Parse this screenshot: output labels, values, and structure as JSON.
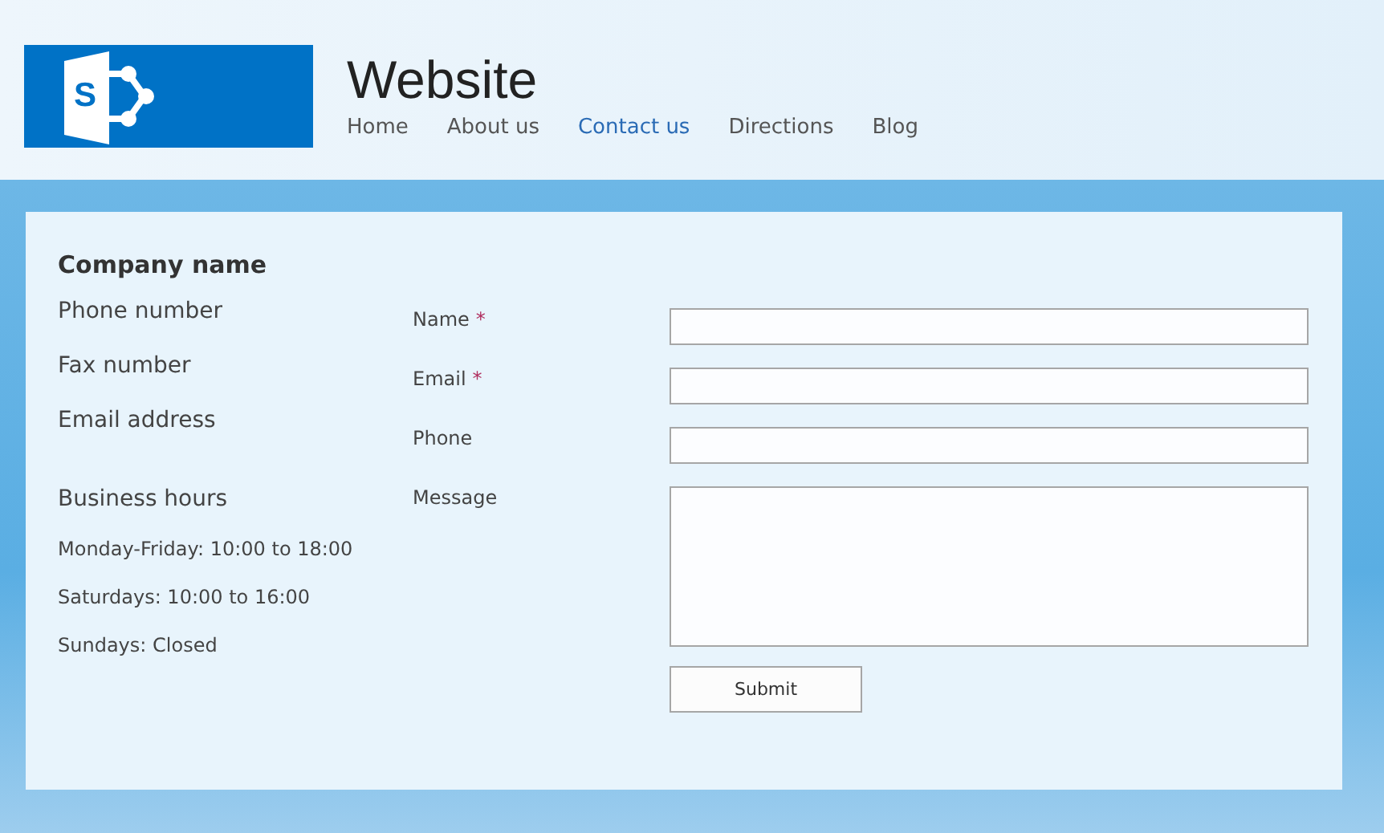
{
  "logo": {
    "letter": "S"
  },
  "site_title": "Website",
  "nav": [
    {
      "label": "Home",
      "selected": false
    },
    {
      "label": "About us",
      "selected": false
    },
    {
      "label": "Contact us",
      "selected": true
    },
    {
      "label": "Directions",
      "selected": false
    },
    {
      "label": "Blog",
      "selected": false
    }
  ],
  "company": {
    "name": "Company name",
    "details": [
      "Phone number",
      "Fax number",
      "Email address"
    ],
    "hours_title": "Business hours",
    "hours": [
      "Monday-Friday: 10:00 to 18:00",
      "Saturdays: 10:00 to 16:00",
      "Sundays: Closed"
    ]
  },
  "form": {
    "required_marker": "*",
    "fields": [
      {
        "label": "Name",
        "required": true,
        "kind": "input"
      },
      {
        "label": "Email",
        "required": true,
        "kind": "input"
      },
      {
        "label": "Phone",
        "required": false,
        "kind": "input"
      },
      {
        "label": "Message",
        "required": false,
        "kind": "textarea"
      }
    ],
    "submit": "Submit"
  }
}
